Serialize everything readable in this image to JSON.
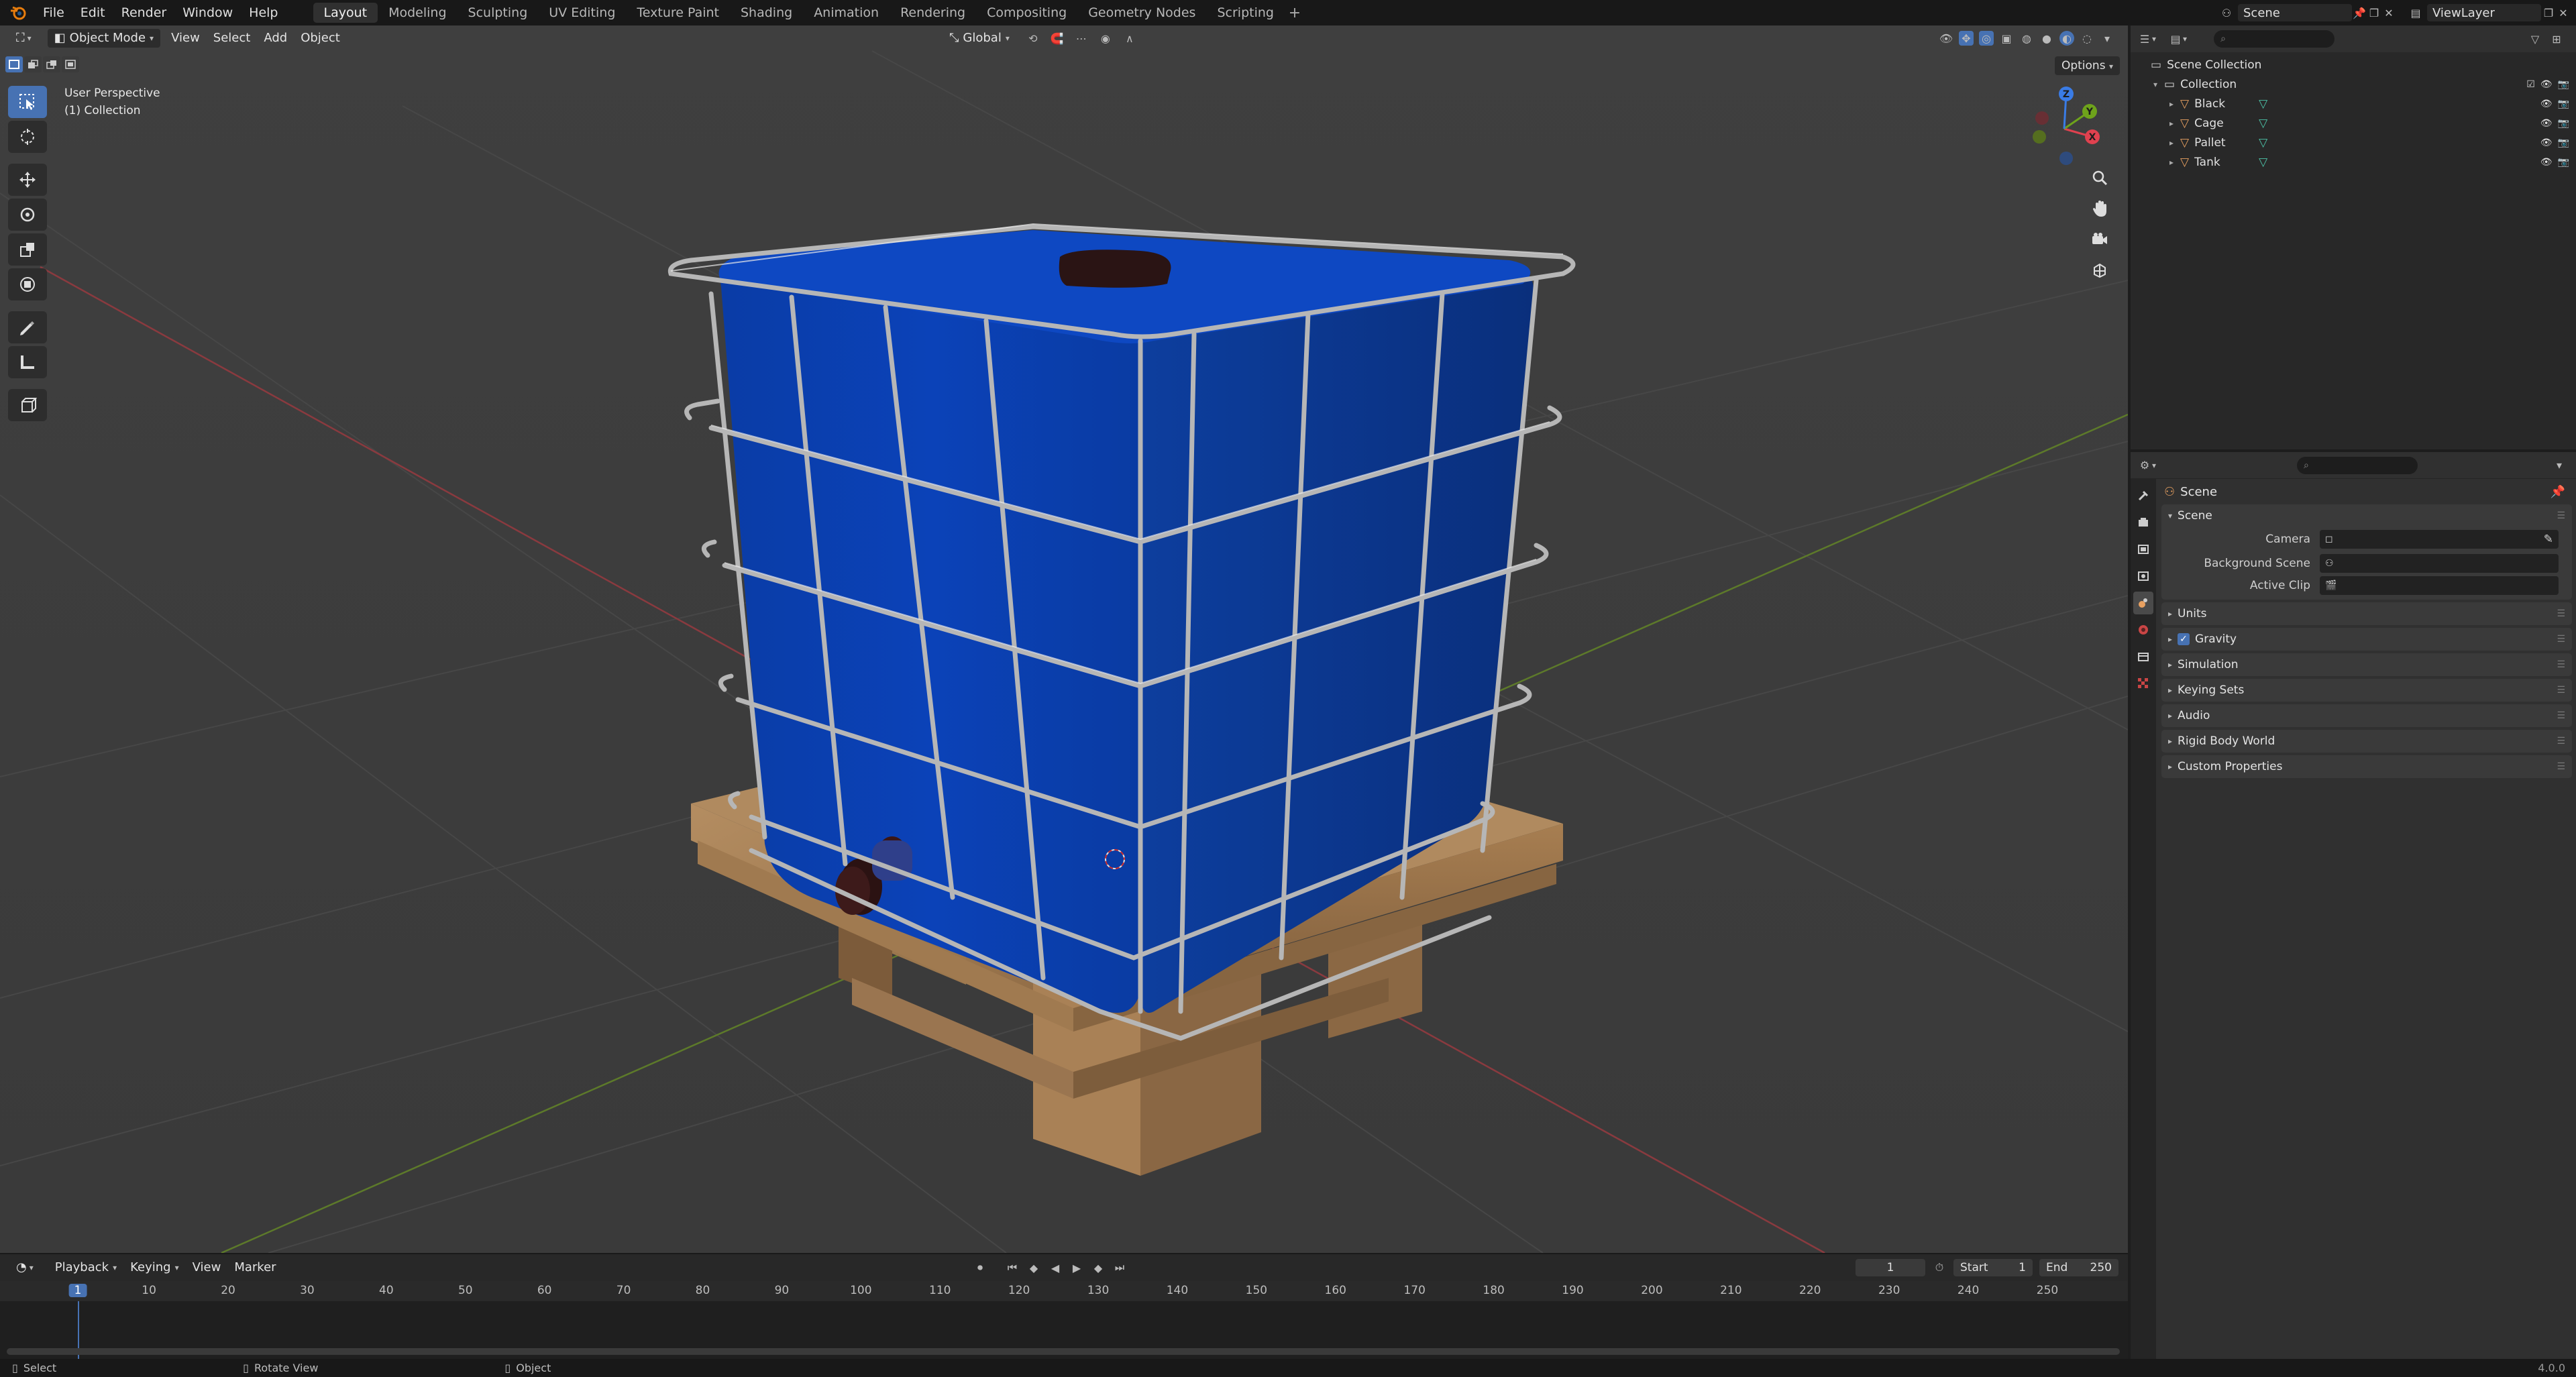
{
  "menus": [
    "File",
    "Edit",
    "Render",
    "Window",
    "Help"
  ],
  "workspaces": [
    "Layout",
    "Modeling",
    "Sculpting",
    "UV Editing",
    "Texture Paint",
    "Shading",
    "Animation",
    "Rendering",
    "Compositing",
    "Geometry Nodes",
    "Scripting"
  ],
  "active_workspace": "Layout",
  "scene_selector": {
    "name": "Scene"
  },
  "viewlayer_selector": {
    "name": "ViewLayer"
  },
  "viewport": {
    "mode": "Object Mode",
    "menus": [
      "View",
      "Select",
      "Add",
      "Object"
    ],
    "transform_orientation": "Global",
    "options_label": "Options",
    "perspective_label": "User Perspective",
    "collection_label": "(1) Collection",
    "gizmo_axes": {
      "x": "X",
      "y": "Y",
      "z": "Z"
    }
  },
  "timeline": {
    "menus": [
      "Playback",
      "Keying",
      "View",
      "Marker"
    ],
    "current_frame": "1",
    "start_label": "Start",
    "start_value": "1",
    "end_label": "End",
    "end_value": "250",
    "ticks": [
      "1",
      "10",
      "20",
      "30",
      "40",
      "50",
      "60",
      "70",
      "80",
      "90",
      "100",
      "110",
      "120",
      "130",
      "140",
      "150",
      "160",
      "170",
      "180",
      "190",
      "200",
      "210",
      "220",
      "230",
      "240",
      "250"
    ]
  },
  "statusbar": {
    "select": "Select",
    "rotate": "Rotate View",
    "object": "Object",
    "version": "4.0.0"
  },
  "outliner": {
    "root": "Scene Collection",
    "collection": "Collection",
    "objects": [
      "Black",
      "Cage",
      "Pallet",
      "Tank"
    ]
  },
  "properties": {
    "title": "Scene",
    "scene_panel": {
      "header": "Scene",
      "camera_label": "Camera",
      "background_scene_label": "Background Scene",
      "active_clip_label": "Active Clip"
    },
    "panels": [
      {
        "label": "Units",
        "checkbox": false
      },
      {
        "label": "Gravity",
        "checkbox": true
      },
      {
        "label": "Simulation",
        "checkbox": false
      },
      {
        "label": "Keying Sets",
        "checkbox": false
      },
      {
        "label": "Audio",
        "checkbox": false
      },
      {
        "label": "Rigid Body World",
        "checkbox": false
      },
      {
        "label": "Custom Properties",
        "checkbox": false
      }
    ]
  },
  "colors": {
    "accent": "#4772b3",
    "tank": "#0b3fae",
    "pallet": "#a07b52",
    "cage": "#a8a8a8",
    "axis_x": "#e0414f",
    "axis_y": "#6ea31b",
    "axis_z": "#3a7ce6"
  }
}
